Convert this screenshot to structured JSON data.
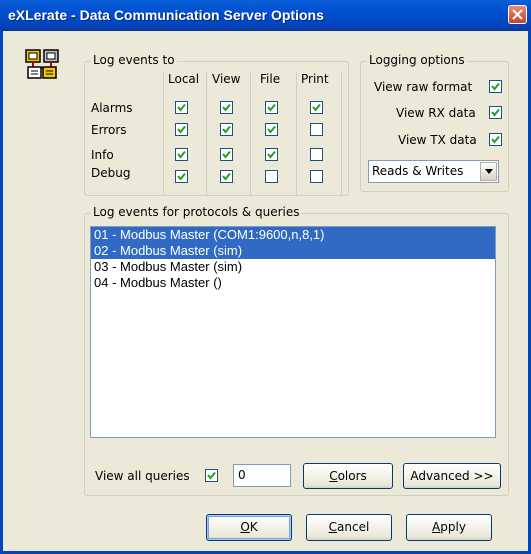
{
  "window": {
    "title": "eXLerate - Data Communication Server Options"
  },
  "log_events_to": {
    "legend": "Log events to",
    "columns": [
      "Local",
      "View",
      "File",
      "Print"
    ],
    "rows": [
      {
        "label": "Alarms",
        "checked": [
          true,
          true,
          true,
          true
        ]
      },
      {
        "label": "Errors",
        "checked": [
          true,
          true,
          true,
          false
        ]
      },
      {
        "label": "Info",
        "checked": [
          true,
          true,
          true,
          false
        ]
      },
      {
        "label": "Debug",
        "checked": [
          true,
          true,
          false,
          false
        ]
      }
    ]
  },
  "logging_options": {
    "legend": "Logging options",
    "view_raw_format": {
      "label": "View raw format",
      "checked": true
    },
    "view_rx_data": {
      "label": "View RX data",
      "checked": true
    },
    "view_tx_data": {
      "label": "View TX data",
      "checked": true
    },
    "read_write_select": {
      "selected": "Reads & Writes"
    }
  },
  "protocols": {
    "legend": "Log events for protocols & queries",
    "items": [
      {
        "text": "01 - Modbus Master (COM1:9600,n,8,1)",
        "selected": true
      },
      {
        "text": "02 - Modbus Master (sim)",
        "selected": true
      },
      {
        "text": "03 - Modbus Master (sim)",
        "selected": false
      },
      {
        "text": "04 - Modbus Master ()",
        "selected": false
      }
    ],
    "view_all_queries": {
      "label": "View all queries",
      "checked": true
    },
    "query_value": "0",
    "colors_hotkey": "C",
    "colors_rest": "olors",
    "advanced_label": "Advanced >>"
  },
  "footer": {
    "ok_hotkey": "O",
    "ok_rest": "K",
    "cancel_hotkey": "C",
    "cancel_rest": "ancel",
    "apply_hotkey": "A",
    "apply_rest": "pply"
  },
  "colors": {
    "titlebar": "#0054e3",
    "selection": "#316ac5",
    "dialog_bg": "#ece9d8",
    "check": "#21a121"
  },
  "icons": [
    "app-network-icon",
    "close-icon",
    "check-icon",
    "chevron-down-icon"
  ]
}
